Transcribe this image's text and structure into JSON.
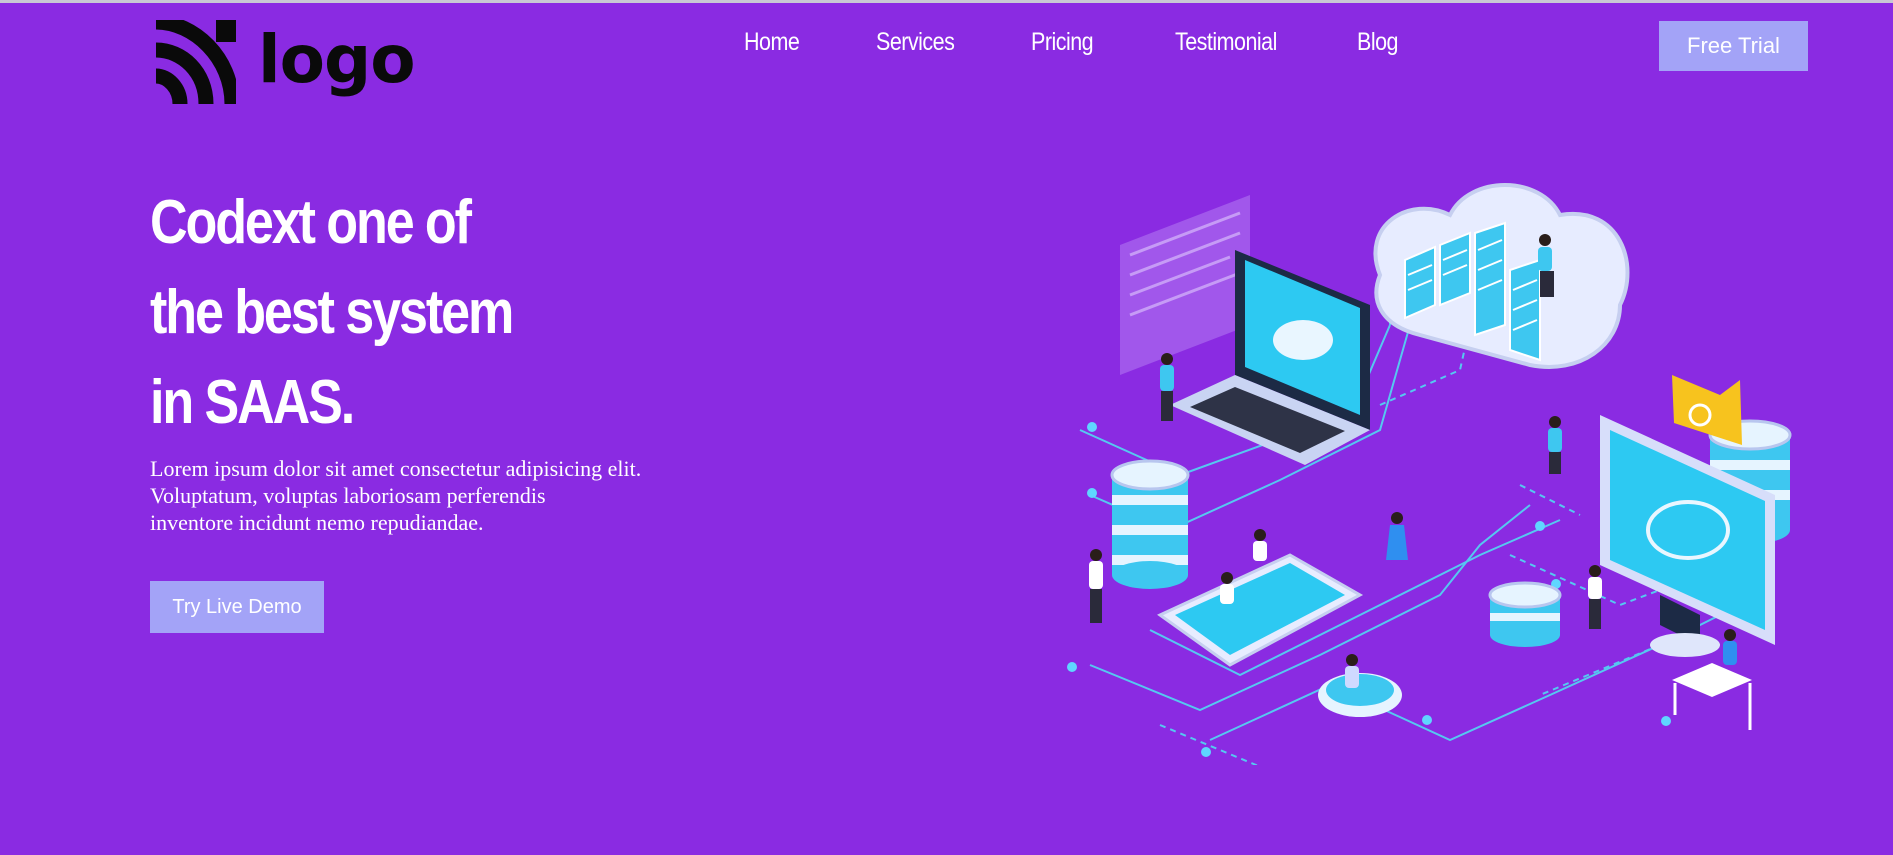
{
  "brand": {
    "logo_text": "logo",
    "logo_icon": "rss-arcs-icon"
  },
  "nav": {
    "items": [
      {
        "label": "Home"
      },
      {
        "label": "Services"
      },
      {
        "label": "Pricing"
      },
      {
        "label": "Testimonial"
      },
      {
        "label": "Blog"
      }
    ],
    "cta_label": "Free Trial"
  },
  "hero": {
    "headline_lines": [
      "Codext one of",
      "the best system",
      "in SAAS."
    ],
    "description_lines": [
      "Lorem ipsum dolor sit amet consectetur adipisicing elit.",
      "Voluptatum, voluptas laboriosam perferendis",
      "inventore incidunt nemo repudiandae."
    ],
    "demo_button_label": "Try Live Demo",
    "illustration": "isometric-cloud-saas-illustration"
  },
  "colors": {
    "background": "#8a2be2",
    "button": "#a3a3f7",
    "text": "#ffffff",
    "illustration_cyan": "#4fd3f5"
  }
}
